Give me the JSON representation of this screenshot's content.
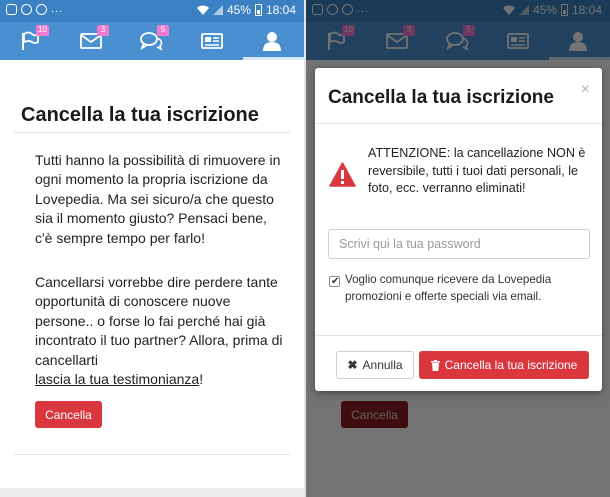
{
  "status_bar": {
    "battery": "45%",
    "time": "18:04",
    "dots": "..."
  },
  "nav": {
    "badges": {
      "flag": "10",
      "messages": "3",
      "chat": "5"
    },
    "icons": [
      "flag-icon",
      "envelope-icon",
      "chat-bubbles-icon",
      "newspaper-icon",
      "user-icon"
    ]
  },
  "page": {
    "title": "Cancella la tua iscrizione",
    "paragraph1": "Tutti hanno la possibilità di rimuovere in ogni momento la propria iscrizione da Lovepedia. Ma sei sicuro/a che questo sia il momento giusto? Pensaci bene, c'è sempre tempo per farlo!",
    "paragraph2_intro": "Cancellarsi vorrebbe dire perdere tante opportunità di conoscere nuove persone.. o forse lo fai perché hai già incontrato il tuo partner? Allora, prima di cancellarti",
    "testimonial_link": "lascia la tua testimonianza",
    "paragraph2_end": "!",
    "cancel_button": "Cancella"
  },
  "modal": {
    "title": "Cancella la tua iscrizione",
    "close": "×",
    "warning": "ATTENZIONE: la cancellazione NON è reversibile, tutti i tuoi dati personali, le foto, ecc. verranno eliminati!",
    "password_placeholder": "Scrivi qui la tua password",
    "password_value": "",
    "newsletter_checked": true,
    "newsletter_label": "Voglio comunque ricevere da Lovepedia promozioni e offerte speciali via email.",
    "cancel_button": "Annulla",
    "confirm_button": "Cancella la tua iscrizione"
  },
  "colors": {
    "statusbar": "#3a80c2",
    "navbar": "#4a90d0",
    "badge": "#f07ad0",
    "danger": "#d9363e"
  }
}
